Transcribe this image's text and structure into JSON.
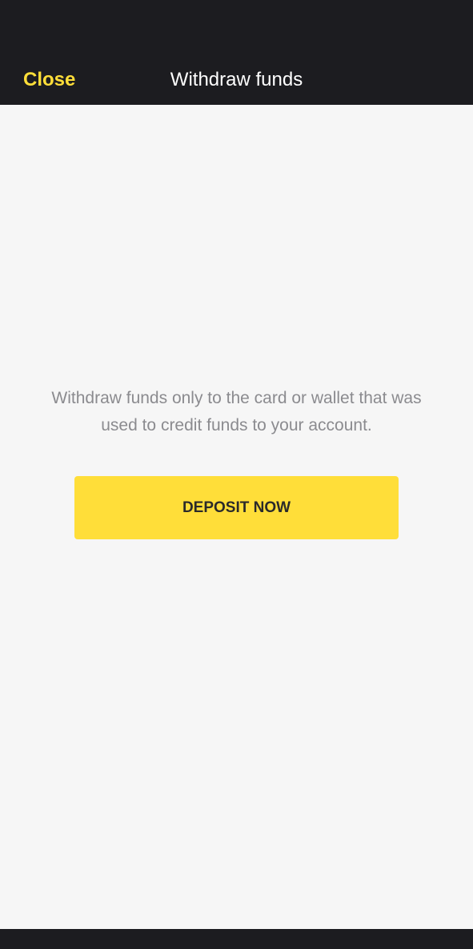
{
  "header": {
    "close_label": "Close",
    "title": "Withdraw funds"
  },
  "main": {
    "notice": "Withdraw funds only to the card or wallet that was used to credit funds to your account.",
    "deposit_label": "DEPOSIT NOW"
  },
  "colors": {
    "accent": "#ffde39",
    "header_bg": "#1c1c20",
    "page_bg": "#f6f6f6",
    "muted_text": "#8b8b8f"
  }
}
